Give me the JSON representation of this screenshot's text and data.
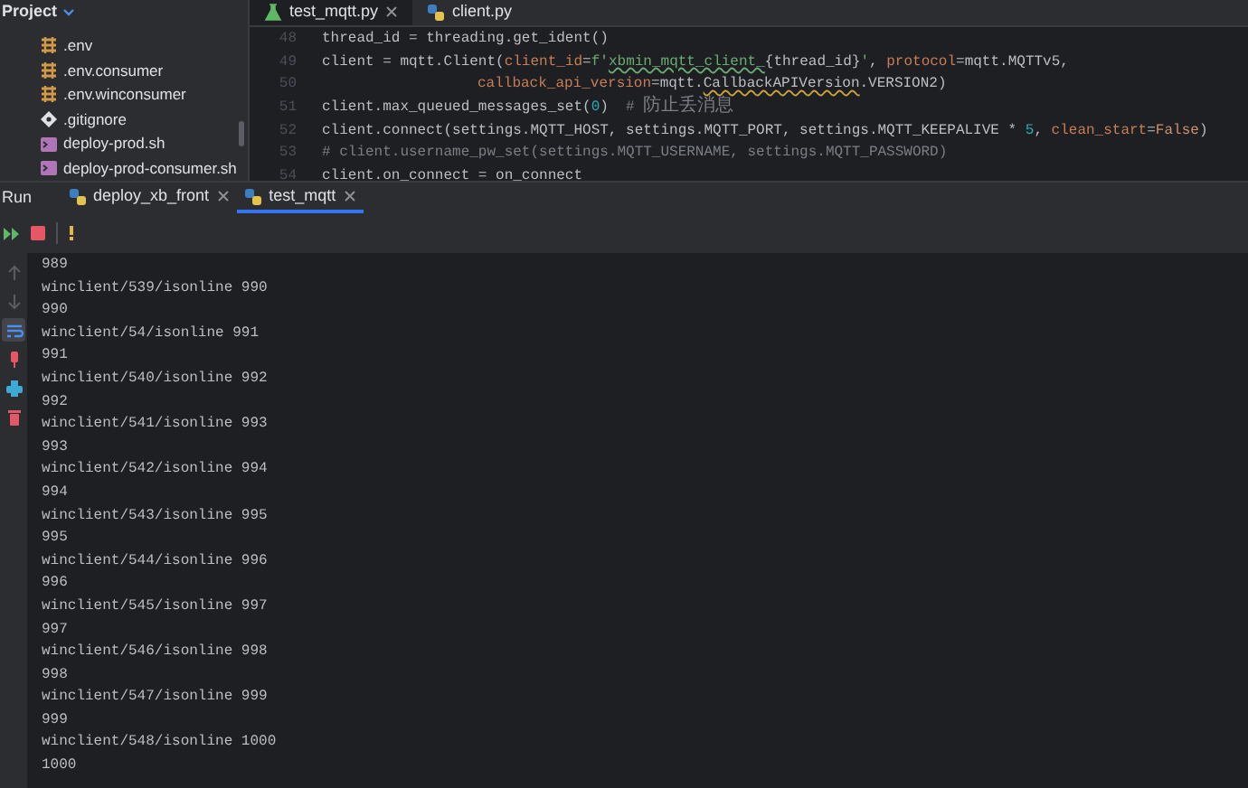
{
  "project_panel": {
    "title": "Project",
    "files": [
      {
        "name": ".env",
        "kind": "env"
      },
      {
        "name": ".env.consumer",
        "kind": "env"
      },
      {
        "name": ".env.winconsumer",
        "kind": "env"
      },
      {
        "name": ".gitignore",
        "kind": "git"
      },
      {
        "name": "deploy-prod.sh",
        "kind": "shell"
      },
      {
        "name": "deploy-prod-consumer.sh",
        "kind": "shell"
      }
    ]
  },
  "editor": {
    "tabs": [
      {
        "label": "test_mqtt.py",
        "kind": "test",
        "selected": true,
        "closable": true
      },
      {
        "label": "client.py",
        "kind": "python",
        "selected": false,
        "closable": false
      }
    ],
    "lines": [
      {
        "number": "48",
        "tokens": [
          {
            "text": "thread_id = threading.get_ident()",
            "kind": "plain"
          }
        ]
      },
      {
        "number": "49",
        "tokens": [
          {
            "text": "client = mqtt.Client(",
            "kind": "plain"
          },
          {
            "text": "client_id",
            "kind": "param"
          },
          {
            "text": "=",
            "kind": "plain"
          },
          {
            "text": "f'",
            "kind": "string"
          },
          {
            "text": "xbmin_mqtt_client_",
            "kind": "typo"
          },
          {
            "text": "{thread_id}",
            "kind": "plain"
          },
          {
            "text": "'",
            "kind": "string"
          },
          {
            "text": ", ",
            "kind": "plain"
          },
          {
            "text": "protocol",
            "kind": "param"
          },
          {
            "text": "=mqtt.MQTTv5,",
            "kind": "plain"
          }
        ]
      },
      {
        "number": "50",
        "kind": "continuation",
        "tokens": [
          {
            "text": "callback_api_version",
            "kind": "param"
          },
          {
            "text": "=mqtt.",
            "kind": "plain"
          },
          {
            "text": "CallbackAPIVersion",
            "kind": "warning"
          },
          {
            "text": ".VERSION2)",
            "kind": "plain"
          }
        ]
      },
      {
        "number": "51",
        "tokens": [
          {
            "text": "client.max_queued_messages_set(",
            "kind": "plain"
          },
          {
            "text": "0",
            "kind": "number"
          },
          {
            "text": ")  ",
            "kind": "plain"
          },
          {
            "text": "# ",
            "kind": "comment"
          },
          {
            "text": "防止丢消息",
            "kind": "comment_cjk"
          }
        ]
      },
      {
        "number": "52",
        "tokens": [
          {
            "text": "client.connect(settings.MQTT_HOST, settings.MQTT_PORT, settings.MQTT_KEEPALIVE * ",
            "kind": "plain"
          },
          {
            "text": "5",
            "kind": "number"
          },
          {
            "text": ", ",
            "kind": "plain"
          },
          {
            "text": "clean_start",
            "kind": "param"
          },
          {
            "text": "=",
            "kind": "plain"
          },
          {
            "text": "False",
            "kind": "keyword"
          },
          {
            "text": ")",
            "kind": "plain"
          }
        ]
      },
      {
        "number": "53",
        "tokens": [
          {
            "text": "# client.username_pw_set(settings.MQTT_USERNAME, settings.MQTT_PASSWORD)",
            "kind": "comment"
          }
        ]
      },
      {
        "number": "54",
        "tokens": [
          {
            "text": "client.on_connect = on_connect",
            "kind": "plain"
          }
        ]
      }
    ]
  },
  "run_panel": {
    "title": "Run",
    "tabs": [
      {
        "label": "deploy_xb_front",
        "selected": false
      },
      {
        "label": "test_mqtt",
        "selected": true
      }
    ],
    "side_tools": [
      {
        "kind": "up",
        "selected": false
      },
      {
        "kind": "down",
        "selected": false
      },
      {
        "kind": "wrap",
        "selected": true
      },
      {
        "kind": "pin",
        "selected": false
      },
      {
        "kind": "print",
        "selected": false
      },
      {
        "kind": "trash",
        "selected": false
      }
    ]
  },
  "console": {
    "lines": [
      "989",
      "winclient/539/isonline 990",
      "990",
      "winclient/54/isonline 991",
      "991",
      "winclient/540/isonline 992",
      "992",
      "winclient/541/isonline 993",
      "993",
      "winclient/542/isonline 994",
      "994",
      "winclient/543/isonline 995",
      "995",
      "winclient/544/isonline 996",
      "996",
      "winclient/545/isonline 997",
      "997",
      "winclient/546/isonline 998",
      "998",
      "winclient/547/isonline 999",
      "999",
      "winclient/548/isonline 1000",
      "1000"
    ]
  }
}
